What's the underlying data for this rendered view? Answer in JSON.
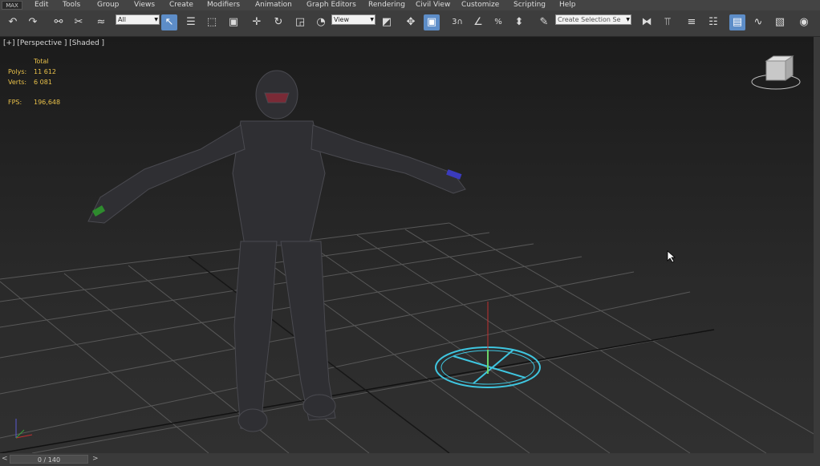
{
  "menu": {
    "logo": "MAX",
    "items": [
      "Edit",
      "Tools",
      "Group",
      "Views",
      "Create",
      "Modifiers",
      "Animation",
      "Graph Editors",
      "Rendering",
      "Civil View",
      "Customize",
      "Scripting",
      "Help"
    ]
  },
  "toolbar": {
    "selection_filter": "All",
    "reference_coord": "View",
    "snap_3": "3",
    "named_selection_placeholder": "Create Selection Se"
  },
  "viewport": {
    "label": "[+] [Perspective ] [Shaded ]",
    "stats": {
      "total_label": "Total",
      "polys_label": "Polys:",
      "polys_value": "11 612",
      "verts_label": "Verts:",
      "verts_value": "6 081",
      "fps_label": "FPS:",
      "fps_value": "196,648"
    },
    "colors": {
      "grid": "#5a5a5a",
      "stats": "#e9c14a",
      "helper": "#3fc6e0",
      "armor": "#2f2f33"
    }
  },
  "timeline": {
    "frame": "0 / 140",
    "prev": "<",
    "next": ">"
  }
}
